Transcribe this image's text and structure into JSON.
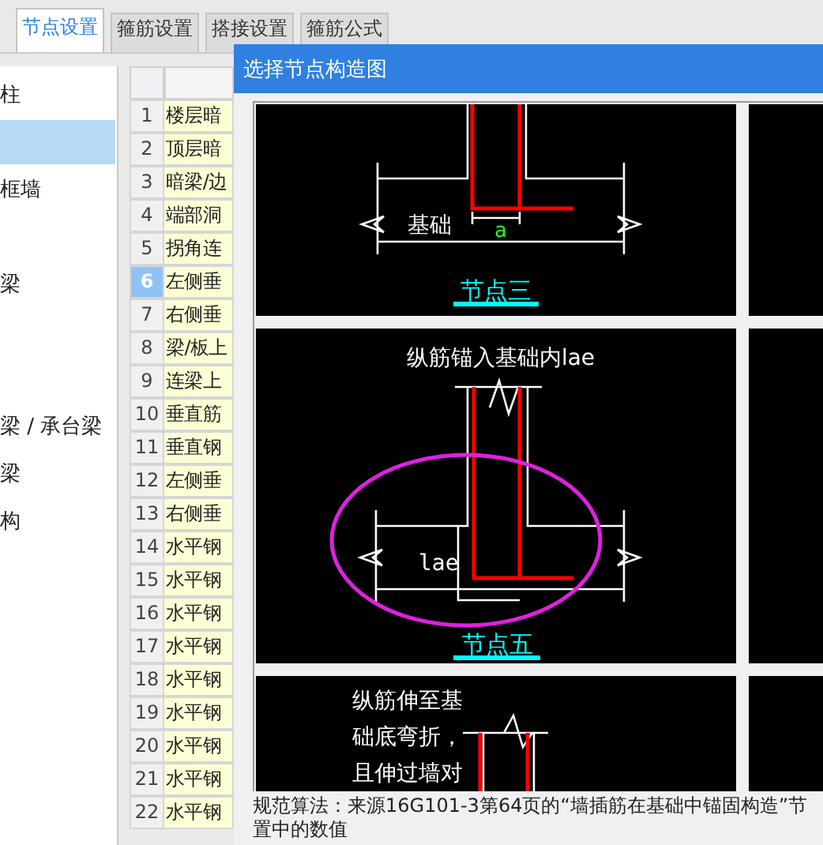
{
  "tabs": [
    {
      "label": "节点设置",
      "selected": true
    },
    {
      "label": "箍筋设置",
      "selected": false
    },
    {
      "label": "搭接设置",
      "selected": false
    },
    {
      "label": "箍筋公式",
      "selected": false
    }
  ],
  "tree": {
    "items": [
      {
        "label": "柱",
        "selected": false
      },
      {
        "selected": true
      },
      {
        "label": "框墙",
        "selected": false
      },
      {
        "selected": false
      },
      {
        "label": "梁",
        "selected": false
      },
      {
        "selected": false
      },
      {
        "selected": false
      },
      {
        "label": "梁 / 承台梁",
        "selected": false
      },
      {
        "label": "梁",
        "selected": false
      },
      {
        "label": "构",
        "selected": false
      }
    ]
  },
  "table": {
    "rows": [
      {
        "number": "1",
        "name": "楼层暗",
        "selected": false
      },
      {
        "number": "2",
        "name": "顶层暗",
        "selected": false
      },
      {
        "number": "3",
        "name": "暗梁/边",
        "selected": false
      },
      {
        "number": "4",
        "name": "端部洞",
        "selected": false
      },
      {
        "number": "5",
        "name": "拐角连",
        "selected": false
      },
      {
        "number": "6",
        "name": "左侧垂",
        "selected": true
      },
      {
        "number": "7",
        "name": "右侧垂",
        "selected": false
      },
      {
        "number": "8",
        "name": "梁/板上",
        "selected": false
      },
      {
        "number": "9",
        "name": "连梁上",
        "selected": false
      },
      {
        "number": "10",
        "name": "垂直筋",
        "selected": false
      },
      {
        "number": "11",
        "name": "垂直钢",
        "selected": false
      },
      {
        "number": "12",
        "name": "左侧垂",
        "selected": false
      },
      {
        "number": "13",
        "name": "右侧垂",
        "selected": false
      },
      {
        "number": "14",
        "name": "水平钢",
        "selected": false
      },
      {
        "number": "15",
        "name": "水平钢",
        "selected": false
      },
      {
        "number": "16",
        "name": "水平钢",
        "selected": false
      },
      {
        "number": "17",
        "name": "水平钢",
        "selected": false
      },
      {
        "number": "18",
        "name": "水平钢",
        "selected": false
      },
      {
        "number": "19",
        "name": "水平钢",
        "selected": false
      },
      {
        "number": "20",
        "name": "水平钢",
        "selected": false
      },
      {
        "number": "21",
        "name": "水平钢",
        "selected": false
      },
      {
        "number": "22",
        "name": "水平钢",
        "selected": false
      }
    ]
  },
  "dialog": {
    "title": "选择节点构造图",
    "diagrams": [
      {
        "kind": "foundation",
        "label": "基础",
        "dimension": "a",
        "caption": "节点三",
        "highlighted": false
      },
      {
        "kind": "anchor",
        "title": "纵筋锚入基础内lae",
        "dimension": "lae",
        "caption": "节点五",
        "highlighted": true
      },
      {
        "kind": "bend",
        "note_lines": [
          "纵筋伸至基",
          "础底弯折，",
          "且伸过墙对"
        ]
      }
    ],
    "description": [
      "规范算法：来源16G101-3第64页的“墙插筋在基础中锚固构造”节",
      "置中的数值"
    ]
  }
}
